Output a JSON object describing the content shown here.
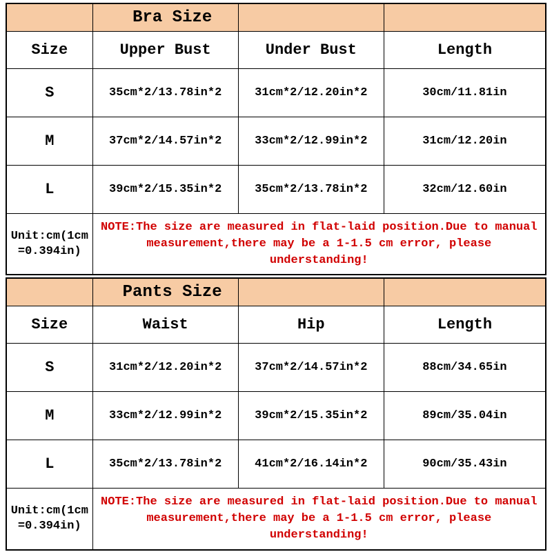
{
  "tables": [
    {
      "title": "Bra Size",
      "columns": [
        "Size",
        "Upper Bust",
        "Under Bust",
        "Length"
      ],
      "rows": [
        {
          "size": "S",
          "c1": "35cm*2/13.78in*2",
          "c2": "31cm*2/12.20in*2",
          "c3": "30cm/11.81in"
        },
        {
          "size": "M",
          "c1": "37cm*2/14.57in*2",
          "c2": "33cm*2/12.99in*2",
          "c3": "31cm/12.20in"
        },
        {
          "size": "L",
          "c1": "39cm*2/15.35in*2",
          "c2": "35cm*2/13.78in*2",
          "c3": "32cm/12.60in"
        }
      ],
      "unit_line1": "Unit:cm(1cm",
      "unit_line2": "=0.394in)",
      "note": "NOTE:The size are measured in flat-laid position.Due to manual measurement,there may be a 1-1.5 cm error, please understanding!"
    },
    {
      "title": "Pants Size",
      "columns": [
        "Size",
        "Waist",
        "Hip",
        "Length"
      ],
      "rows": [
        {
          "size": "S",
          "c1": "31cm*2/12.20in*2",
          "c2": "37cm*2/14.57in*2",
          "c3": "88cm/34.65in"
        },
        {
          "size": "M",
          "c1": "33cm*2/12.99in*2",
          "c2": "39cm*2/15.35in*2",
          "c3": "89cm/35.04in"
        },
        {
          "size": "L",
          "c1": "35cm*2/13.78in*2",
          "c2": "41cm*2/16.14in*2",
          "c3": "90cm/35.43in"
        }
      ],
      "unit_line1": "Unit:cm(1cm",
      "unit_line2": "=0.394in)",
      "note": "NOTE:The size are measured in flat-laid position.Due to manual measurement,there may be a 1-1.5 cm error, please understanding!"
    }
  ]
}
